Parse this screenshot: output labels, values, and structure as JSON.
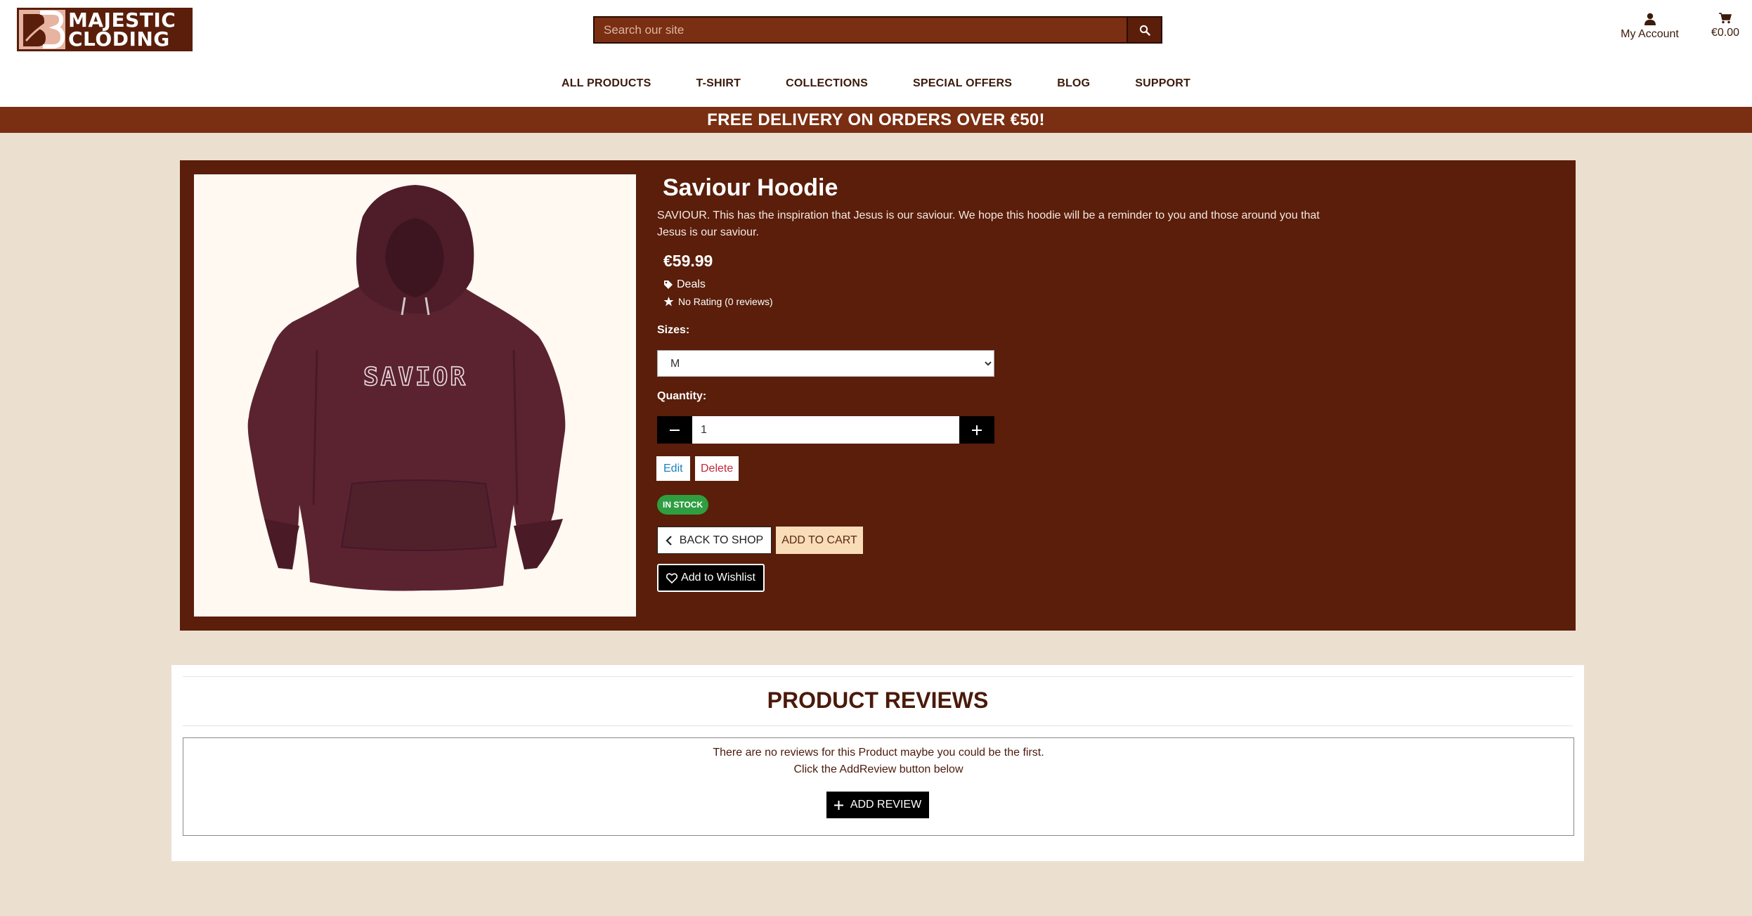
{
  "header": {
    "logo_line1": "MAJESTIC",
    "logo_line2": "CLODING",
    "search_placeholder": "Search our site",
    "account_label": "My Account",
    "cart_total": "€0.00"
  },
  "nav": [
    "ALL PRODUCTS",
    "T-SHIRT",
    "COLLECTIONS",
    "SPECIAL OFFERS",
    "BLOG",
    "SUPPORT"
  ],
  "banner": "FREE DELIVERY ON ORDERS OVER €50!",
  "product": {
    "title": "Saviour Hoodie",
    "description": "SAVIOUR. This has the inspiration that Jesus is our saviour. We hope this hoodie will be a reminder to you and those around you that Jesus is our saviour.",
    "price": "€59.99",
    "category": "Deals",
    "rating": "No Rating (0 reviews)",
    "image_print": "SAVIOR",
    "sizes_label": "Sizes:",
    "size_selected": "M",
    "quantity_label": "Quantity:",
    "quantity": "1",
    "edit_label": "Edit",
    "delete_label": "Delete",
    "stock_label": "IN STOCK",
    "back_label": "BACK TO SHOP",
    "add_to_cart_label": "ADD TO CART",
    "wishlist_label": "Add to Wishlist"
  },
  "reviews": {
    "title": "PRODUCT REVIEWS",
    "empty_line1": "There are no reviews for this Product maybe you could be the first.",
    "empty_line2": "Click the AddReview button below",
    "add_label": "ADD REVIEW"
  },
  "colors": {
    "brand_dark": "#5a1e0a",
    "brand_mid": "#7a2e12",
    "page_bg": "#ebe0d0",
    "stock_green": "#2e9e40",
    "cart_button": "#f9dcb8"
  }
}
